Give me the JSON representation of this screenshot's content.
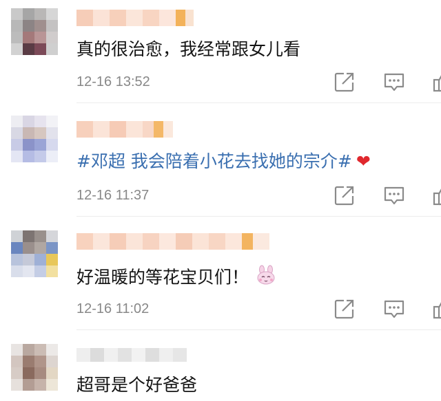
{
  "comments": [
    {
      "text": "真的很治愈，我经常跟女儿看",
      "time": "12-16 13:52",
      "emoji": ""
    },
    {
      "text": "#邓超 我会陪着小花去找她的宗介#",
      "time": "12-16 11:37",
      "emoji": "❤"
    },
    {
      "text": "好温暖的等花宝贝们！",
      "time": "12-16 11:02",
      "emoji": "bunny"
    },
    {
      "text": "超哥是个好爸爸",
      "time": "",
      "emoji": ""
    }
  ],
  "icons": {
    "share": "share-icon",
    "reply": "comment-bubble-icon",
    "like": "thumb-up-icon"
  },
  "colors": {
    "topic_link": "#3a6fb0",
    "timestamp": "#888888",
    "heart": "#e0282e"
  }
}
